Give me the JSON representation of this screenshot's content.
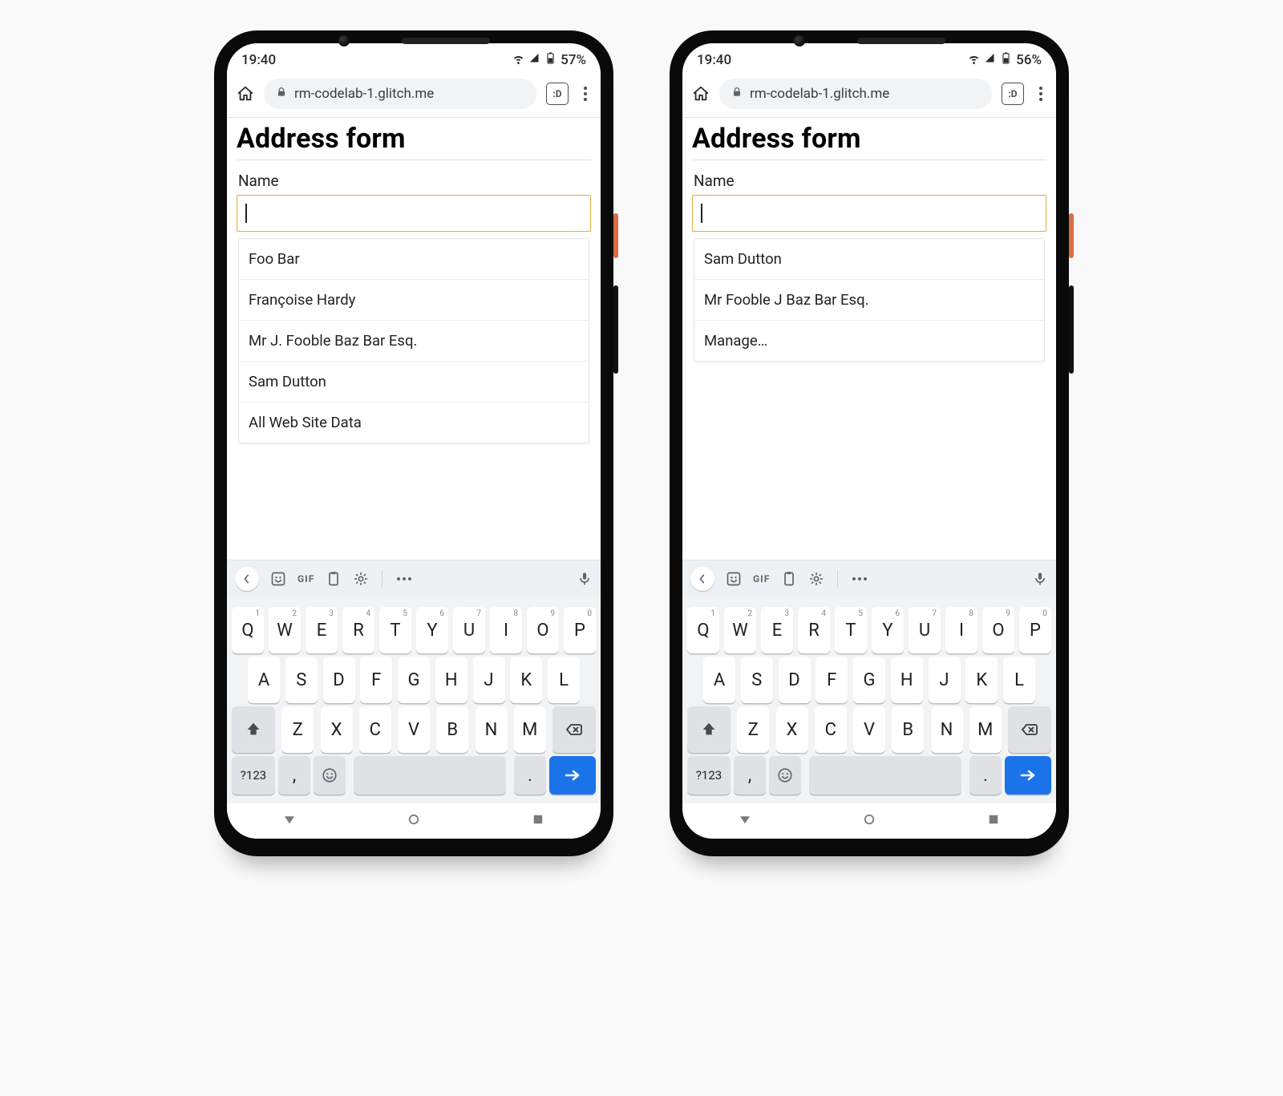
{
  "phones": [
    {
      "status": {
        "time": "19:40",
        "battery": "57%"
      },
      "url": "rm-codelab-1.glitch.me",
      "reader_badge": ":D",
      "page": {
        "title": "Address form",
        "name_label": "Name",
        "name_value": "",
        "suggestions": [
          "Foo Bar",
          "Françoise Hardy",
          "Mr J. Fooble Baz Bar Esq.",
          "Sam Dutton",
          "All Web Site Data"
        ]
      }
    },
    {
      "status": {
        "time": "19:40",
        "battery": "56%"
      },
      "url": "rm-codelab-1.glitch.me",
      "reader_badge": ":D",
      "page": {
        "title": "Address form",
        "name_label": "Name",
        "name_value": "",
        "suggestions": [
          "Sam Dutton",
          "Mr Fooble J Baz Bar Esq.",
          "Manage…"
        ]
      }
    }
  ],
  "keyboard": {
    "strip_gif": "GIF",
    "row1": [
      "Q",
      "W",
      "E",
      "R",
      "T",
      "Y",
      "U",
      "I",
      "O",
      "P"
    ],
    "row1_super": [
      "1",
      "2",
      "3",
      "4",
      "5",
      "6",
      "7",
      "8",
      "9",
      "0"
    ],
    "row2": [
      "A",
      "S",
      "D",
      "F",
      "G",
      "H",
      "J",
      "K",
      "L"
    ],
    "row3": [
      "Z",
      "X",
      "C",
      "V",
      "B",
      "N",
      "M"
    ],
    "sym_key": "?123",
    "comma_key": ",",
    "period_key": "."
  }
}
